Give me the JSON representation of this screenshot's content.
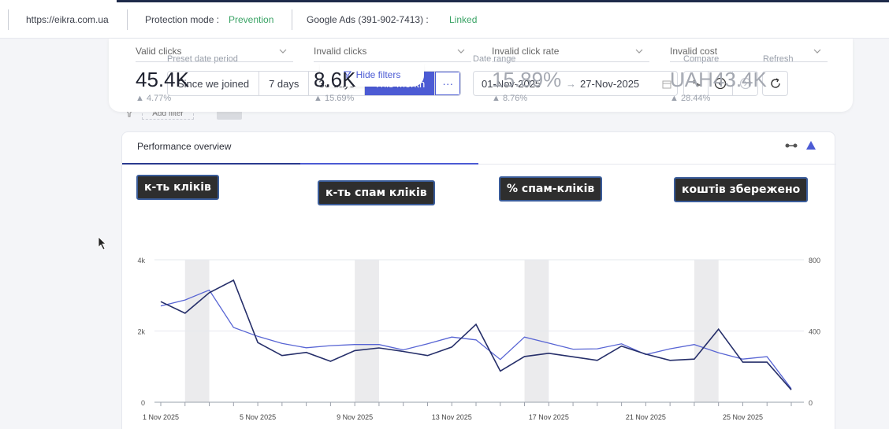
{
  "topbar": {
    "site": "https://eikra.com.ua",
    "protection_label": "Protection mode :",
    "protection_value": "Prevention",
    "ads_label": "Google Ads (391-902-7413) :",
    "ads_value": "Linked"
  },
  "filters": {
    "preset_label": "Preset date period",
    "presets": [
      "Since we joined",
      "7 days",
      "30 days",
      "This month"
    ],
    "more": "···",
    "daterange_label": "Date range",
    "date_from": "01-Nov-2025",
    "arrow": "→",
    "date_to": "27-Nov-2025",
    "compare_label": "Compare",
    "refresh_label": "Refresh",
    "hide_filters": "Hide filters",
    "add_filter": "Add filter"
  },
  "performance": {
    "title": "Performance overview",
    "metrics": [
      {
        "name": "Valid clicks",
        "value": "45.4K",
        "delta": "4.77%",
        "tooltip": "к-ть кліків"
      },
      {
        "name": "Invalid clicks",
        "value": "8.6K",
        "delta": "15.69%",
        "tooltip": "к-ть спам кліків"
      },
      {
        "name": "Invalid click rate",
        "value": "15.89%",
        "delta": "8.76%",
        "tooltip": "% спам-кліків"
      },
      {
        "name": "Invalid cost",
        "value": "UAH43.4K",
        "delta": "28.44%",
        "tooltip": "коштів збережено"
      }
    ]
  },
  "chart_data": {
    "type": "line",
    "x": [
      "1 Nov 2025",
      "2 Nov 2025",
      "3 Nov 2025",
      "4 Nov 2025",
      "5 Nov 2025",
      "6 Nov 2025",
      "7 Nov 2025",
      "8 Nov 2025",
      "9 Nov 2025",
      "10 Nov 2025",
      "11 Nov 2025",
      "12 Nov 2025",
      "13 Nov 2025",
      "14 Nov 2025",
      "15 Nov 2025",
      "16 Nov 2025",
      "17 Nov 2025",
      "18 Nov 2025",
      "19 Nov 2025",
      "20 Nov 2025",
      "21 Nov 2025",
      "22 Nov 2025",
      "23 Nov 2025",
      "24 Nov 2025",
      "25 Nov 2025",
      "26 Nov 2025",
      "27 Nov 2025"
    ],
    "x_tick_labels": [
      "1 Nov 2025",
      "5 Nov 2025",
      "9 Nov 2025",
      "13 Nov 2025",
      "17 Nov 2025",
      "21 Nov 2025",
      "25 Nov 2025"
    ],
    "y_left_ticks": [
      "0",
      "2k",
      "4k"
    ],
    "y_right_ticks": [
      "0",
      "400",
      "800"
    ],
    "ylim_left": [
      0,
      4000
    ],
    "ylim_right": [
      0,
      800
    ],
    "weekend_bands": [
      [
        1,
        2
      ],
      [
        8,
        9
      ],
      [
        15,
        16
      ],
      [
        22,
        23
      ]
    ],
    "series": [
      {
        "axis": "left",
        "color": "#5865d4",
        "values": [
          2700,
          2870,
          3150,
          2100,
          1850,
          1650,
          1530,
          1590,
          1620,
          1620,
          1470,
          1640,
          1830,
          1750,
          1200,
          1830,
          1660,
          1490,
          1500,
          1640,
          1340,
          1500,
          1620,
          1390,
          1210,
          1280,
          380
        ]
      },
      {
        "axis": "right",
        "color": "#262f6a",
        "values": [
          565,
          500,
          615,
          685,
          335,
          262,
          280,
          230,
          290,
          305,
          285,
          262,
          310,
          437,
          175,
          257,
          275,
          255,
          235,
          315,
          270,
          235,
          242,
          410,
          225,
          225,
          70
        ]
      }
    ],
    "grid": true
  }
}
